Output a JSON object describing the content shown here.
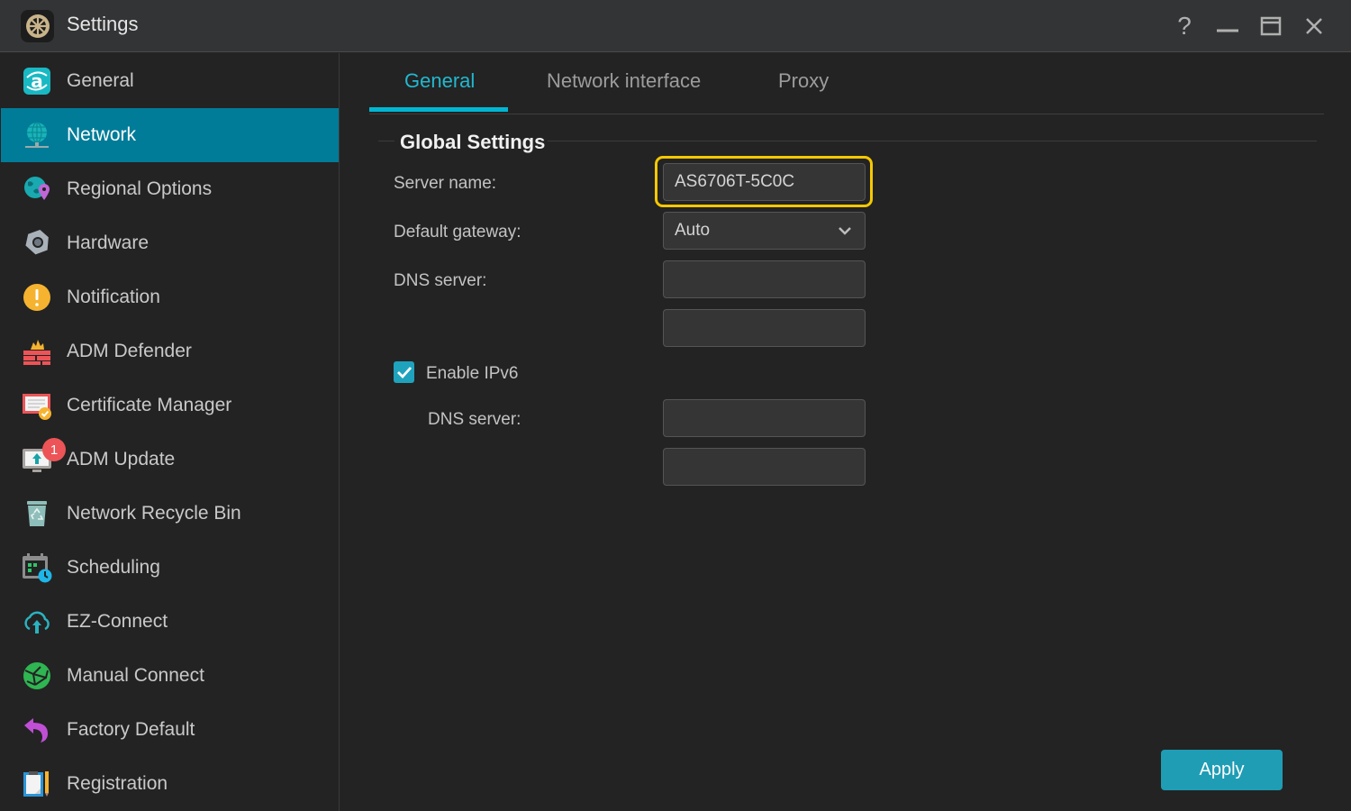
{
  "window": {
    "title": "Settings",
    "controls": {
      "help": "?",
      "minimize": "minimize",
      "maximize": "maximize",
      "close": "close"
    }
  },
  "sidebar": {
    "active_index": 1,
    "items": [
      {
        "label": "General",
        "icon": "adm-general-icon"
      },
      {
        "label": "Network",
        "icon": "globe-network-icon"
      },
      {
        "label": "Regional Options",
        "icon": "globe-pin-icon"
      },
      {
        "label": "Hardware",
        "icon": "hex-nut-icon"
      },
      {
        "label": "Notification",
        "icon": "alert-circle-icon"
      },
      {
        "label": "ADM Defender",
        "icon": "firewall-icon"
      },
      {
        "label": "Certificate Manager",
        "icon": "certificate-check-icon"
      },
      {
        "label": "ADM Update",
        "icon": "monitor-upload-icon",
        "badge": "1"
      },
      {
        "label": "Network Recycle Bin",
        "icon": "recycle-bin-icon"
      },
      {
        "label": "Scheduling",
        "icon": "calendar-clock-icon"
      },
      {
        "label": "EZ-Connect",
        "icon": "cloud-upload-icon"
      },
      {
        "label": "Manual Connect",
        "icon": "network-ball-icon"
      },
      {
        "label": "Factory Default",
        "icon": "undo-arrow-icon"
      },
      {
        "label": "Registration",
        "icon": "clipboard-pencil-icon"
      }
    ]
  },
  "tabs": [
    {
      "label": "General",
      "active": true
    },
    {
      "label": "Network interface",
      "active": false
    },
    {
      "label": "Proxy",
      "active": false
    }
  ],
  "global_settings": {
    "title": "Global Settings",
    "server_name": {
      "label": "Server name:",
      "value": "AS6706T-5C0C"
    },
    "default_gateway": {
      "label": "Default gateway:",
      "value": "Auto"
    },
    "dns_server": {
      "label": "DNS server:",
      "primary": "",
      "secondary": ""
    },
    "ipv6": {
      "label": "Enable IPv6",
      "checked": true,
      "dns_label": "DNS server:",
      "primary": "",
      "secondary": ""
    }
  },
  "footer": {
    "apply_label": "Apply"
  },
  "colors": {
    "accent": "#00b7d3",
    "active_sidebar": "#007c99",
    "focus_ring": "#f5c800",
    "apply_button": "#1f9db5",
    "badge": "#ec5457"
  }
}
